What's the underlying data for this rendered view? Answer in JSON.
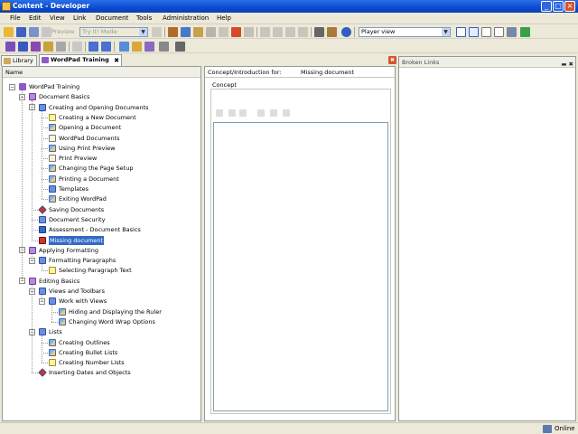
{
  "window": {
    "title": "Content - Developer"
  },
  "menu": [
    "File",
    "Edit",
    "View",
    "Link",
    "Document",
    "Tools",
    "Administration",
    "Help"
  ],
  "toolbar": {
    "preview_label": "Preview",
    "mode_combo": "Try It! Mode",
    "view_combo": "Player view"
  },
  "tabs": [
    {
      "label": "Library"
    },
    {
      "label": "WordPad Training"
    }
  ],
  "tree": {
    "column_header": "Name",
    "items": [
      {
        "label": "WordPad Training",
        "level": 0,
        "icon": "course"
      },
      {
        "label": "Document Basics",
        "level": 1,
        "icon": "chapter"
      },
      {
        "label": "Creating and Opening Documents",
        "level": 2,
        "icon": "topic"
      },
      {
        "label": "Creating a New Document",
        "level": 3,
        "icon": "idea"
      },
      {
        "label": "Opening a Document",
        "level": 3,
        "icon": "mixed"
      },
      {
        "label": "WordPad Documents",
        "level": 3,
        "icon": "page"
      },
      {
        "label": "Using Print Preview",
        "level": 3,
        "icon": "mixed"
      },
      {
        "label": "Print Preview",
        "level": 3,
        "icon": "page"
      },
      {
        "label": "Changing the Page Setup",
        "level": 3,
        "icon": "mixed"
      },
      {
        "label": "Printing a Document",
        "level": 3,
        "icon": "mixed"
      },
      {
        "label": "Templates",
        "level": 3,
        "icon": "topic"
      },
      {
        "label": "Exiting WordPad",
        "level": 3,
        "icon": "mixed"
      },
      {
        "label": "Saving Documents",
        "level": 2,
        "icon": "diamond"
      },
      {
        "label": "Document Security",
        "level": 2,
        "icon": "topic"
      },
      {
        "label": "Assessment - Document Basics",
        "level": 2,
        "icon": "assess"
      },
      {
        "label": "Missing document",
        "level": 2,
        "icon": "missing",
        "selected": true
      },
      {
        "label": "Applying Formatting",
        "level": 1,
        "icon": "chapter"
      },
      {
        "label": "Formatting Paragraphs",
        "level": 2,
        "icon": "topic"
      },
      {
        "label": "Selecting Paragraph Text",
        "level": 3,
        "icon": "idea"
      },
      {
        "label": "Editing Basics",
        "level": 1,
        "icon": "chapter"
      },
      {
        "label": "Views and Toolbars",
        "level": 2,
        "icon": "topic"
      },
      {
        "label": "Work with Views",
        "level": 3,
        "icon": "topic"
      },
      {
        "label": "Hiding and Displaying the Ruler",
        "level": 4,
        "icon": "mixed"
      },
      {
        "label": "Changing Word Wrap Options",
        "level": 4,
        "icon": "mixed"
      },
      {
        "label": "Lists",
        "level": 2,
        "icon": "topic"
      },
      {
        "label": "Creating Outlines",
        "level": 3,
        "icon": "mixed"
      },
      {
        "label": "Creating Bullet Lists",
        "level": 3,
        "icon": "mixed"
      },
      {
        "label": "Creating Number Lists",
        "level": 3,
        "icon": "idea"
      },
      {
        "label": "Inserting Dates and Objects",
        "level": 2,
        "icon": "diamond"
      }
    ]
  },
  "concept": {
    "header_key": "Concept/Introduction for:",
    "header_value": "Missing document",
    "label": "Concept"
  },
  "broken_links": {
    "title": "Broken Links"
  },
  "status": {
    "text": "Online"
  }
}
